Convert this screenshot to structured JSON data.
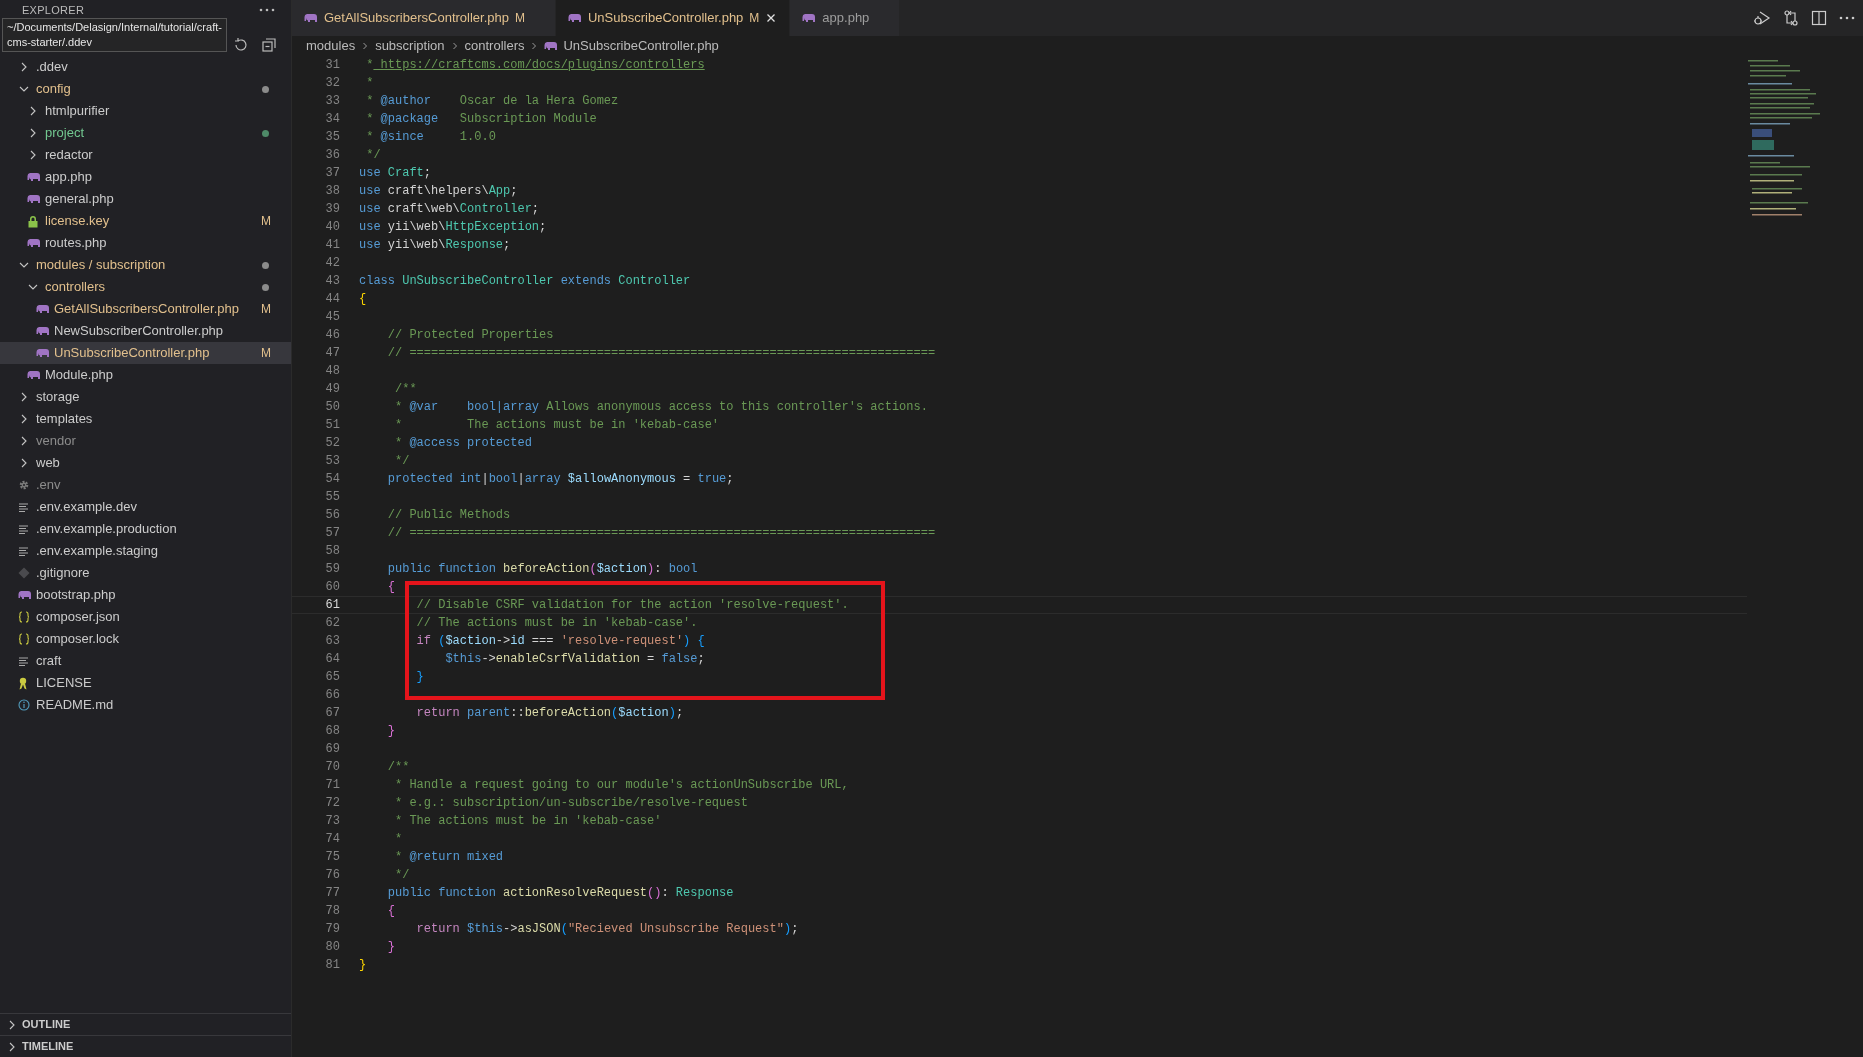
{
  "sidebar": {
    "title": "EXPLORER",
    "tooltip": "~/Documents/Delasign/Internal/tutorial/craft-\ncms-starter/.ddev",
    "tree": [
      {
        "name": ".ddev",
        "kind": "folder",
        "expanded": false,
        "selected": false
      },
      {
        "name": "config",
        "kind": "folder",
        "expanded": true,
        "color": "#e2c08d",
        "dot": {
          "color": "#8b8b8b"
        },
        "selected": false,
        "children": [
          {
            "name": "htmlpurifier",
            "kind": "folder",
            "expanded": false,
            "selected": false
          },
          {
            "name": "project",
            "kind": "folder",
            "expanded": false,
            "color": "#73c991",
            "dot": {
              "color": "#4e8a68"
            },
            "selected": false
          },
          {
            "name": "redactor",
            "kind": "folder",
            "expanded": false,
            "selected": false
          },
          {
            "name": "app.php",
            "kind": "php",
            "selected": false
          },
          {
            "name": "general.php",
            "kind": "php",
            "selected": false
          },
          {
            "name": "license.key",
            "kind": "key",
            "color": "#e2c08d",
            "badge": "M",
            "selected": false
          },
          {
            "name": "routes.php",
            "kind": "php",
            "selected": false
          }
        ]
      },
      {
        "name": "modules / subscription",
        "kind": "folder",
        "expanded": true,
        "color": "#e2c08d",
        "dot": {
          "color": "#8b8b8b"
        },
        "selected": false,
        "children": [
          {
            "name": "controllers",
            "kind": "folder",
            "expanded": true,
            "color": "#e2c08d",
            "dot": {
              "color": "#8b8b8b"
            },
            "selected": false,
            "children": [
              {
                "name": "GetAllSubscribersController.php",
                "kind": "php",
                "color": "#e2c08d",
                "badge": "M",
                "selected": false
              },
              {
                "name": "NewSubscriberController.php",
                "kind": "php",
                "selected": false
              },
              {
                "name": "UnSubscribeController.php",
                "kind": "php",
                "color": "#e2c08d",
                "badge": "M",
                "selected": true
              }
            ]
          },
          {
            "name": "Module.php",
            "kind": "php",
            "selected": false
          }
        ]
      },
      {
        "name": "storage",
        "kind": "folder",
        "expanded": false,
        "selected": false
      },
      {
        "name": "templates",
        "kind": "folder",
        "expanded": false,
        "selected": false
      },
      {
        "name": "vendor",
        "kind": "folder",
        "expanded": false,
        "color": "#8c8c8c",
        "selected": false
      },
      {
        "name": "web",
        "kind": "folder",
        "expanded": false,
        "selected": false
      },
      {
        "name": ".env",
        "kind": "settings",
        "color": "#8c8c8c",
        "selected": false
      },
      {
        "name": ".env.example.dev",
        "kind": "text",
        "selected": false
      },
      {
        "name": ".env.example.production",
        "kind": "text",
        "selected": false
      },
      {
        "name": ".env.example.staging",
        "kind": "text",
        "selected": false
      },
      {
        "name": ".gitignore",
        "kind": "git",
        "selected": false
      },
      {
        "name": "bootstrap.php",
        "kind": "php",
        "selected": false
      },
      {
        "name": "composer.json",
        "kind": "json",
        "selected": false
      },
      {
        "name": "composer.lock",
        "kind": "json",
        "selected": false
      },
      {
        "name": "craft",
        "kind": "text",
        "selected": false
      },
      {
        "name": "LICENSE",
        "kind": "license",
        "selected": false
      },
      {
        "name": "README.md",
        "kind": "info",
        "selected": false
      }
    ],
    "panels": [
      {
        "label": "OUTLINE",
        "expanded": false
      },
      {
        "label": "TIMELINE",
        "expanded": false
      }
    ]
  },
  "tabs": [
    {
      "label": "GetAllSubscribersController.php",
      "badge": "M",
      "color": "#e2c08d",
      "selected": false
    },
    {
      "label": "UnSubscribeController.php",
      "badge": "M",
      "color": "#e2c08d",
      "selected": true
    },
    {
      "label": "app.php",
      "selected": false
    }
  ],
  "breadcrumb": [
    {
      "label": "modules"
    },
    {
      "label": "subscription"
    },
    {
      "label": "controllers"
    },
    {
      "label": "UnSubscribeController.php",
      "kind": "php"
    }
  ],
  "editor": {
    "lines": [
      {
        "number": "31",
        "current": false,
        "tokens": [
          {
            "kind": "comment",
            "text": " *"
          },
          {
            "kind": "link",
            "text": " https://craftcms.com/docs/plugins/controllers"
          }
        ]
      },
      {
        "number": "32",
        "current": false,
        "tokens": [
          {
            "kind": "comment",
            "text": " *"
          }
        ]
      },
      {
        "number": "33",
        "current": false,
        "tokens": [
          {
            "kind": "comment",
            "text": " *"
          },
          {
            "kind": "doctag",
            "text": " @author"
          },
          {
            "kind": "comment",
            "text": "    Oscar de la Hera Gomez"
          }
        ]
      },
      {
        "number": "34",
        "current": false,
        "tokens": [
          {
            "kind": "comment",
            "text": " *"
          },
          {
            "kind": "doctag",
            "text": " @package"
          },
          {
            "kind": "comment",
            "text": "   Subscription Module"
          }
        ]
      },
      {
        "number": "35",
        "current": false,
        "tokens": [
          {
            "kind": "comment",
            "text": " *"
          },
          {
            "kind": "doctag",
            "text": " @since"
          },
          {
            "kind": "comment",
            "text": "     1.0.0"
          }
        ]
      },
      {
        "number": "36",
        "current": false,
        "tokens": [
          {
            "kind": "comment",
            "text": " */"
          }
        ]
      },
      {
        "number": "37",
        "current": false,
        "tokens": [
          {
            "kind": "keyword",
            "text": "use"
          },
          {
            "kind": "type",
            "text": " Craft"
          },
          {
            "kind": "plain",
            "text": ";"
          }
        ]
      },
      {
        "number": "38",
        "current": false,
        "tokens": [
          {
            "kind": "keyword",
            "text": "use"
          },
          {
            "kind": "plain",
            "text": " craft\\helpers\\"
          },
          {
            "kind": "type",
            "text": "App"
          },
          {
            "kind": "plain",
            "text": ";"
          }
        ]
      },
      {
        "number": "39",
        "current": false,
        "tokens": [
          {
            "kind": "keyword",
            "text": "use"
          },
          {
            "kind": "plain",
            "text": " craft\\web\\"
          },
          {
            "kind": "type",
            "text": "Controller"
          },
          {
            "kind": "plain",
            "text": ";"
          }
        ]
      },
      {
        "number": "40",
        "current": false,
        "tokens": [
          {
            "kind": "keyword",
            "text": "use"
          },
          {
            "kind": "plain",
            "text": " yii\\web\\"
          },
          {
            "kind": "type",
            "text": "HttpException"
          },
          {
            "kind": "plain",
            "text": ";"
          }
        ]
      },
      {
        "number": "41",
        "current": false,
        "tokens": [
          {
            "kind": "keyword",
            "text": "use"
          },
          {
            "kind": "plain",
            "text": " yii\\web\\"
          },
          {
            "kind": "type",
            "text": "Response"
          },
          {
            "kind": "plain",
            "text": ";"
          }
        ]
      },
      {
        "number": "42",
        "current": false
      },
      {
        "number": "43",
        "current": false,
        "tokens": [
          {
            "kind": "keyword",
            "text": "class"
          },
          {
            "kind": "type",
            "text": " UnSubscribeController"
          },
          {
            "kind": "keyword",
            "text": " extends"
          },
          {
            "kind": "type",
            "text": " Controller"
          }
        ]
      },
      {
        "number": "44",
        "current": false,
        "tokens": [
          {
            "kind": "bracket1",
            "text": "{"
          }
        ]
      },
      {
        "number": "45",
        "current": false
      },
      {
        "number": "46",
        "current": false,
        "tokens": [
          {
            "kind": "comment",
            "text": "    // Protected Properties"
          }
        ]
      },
      {
        "number": "47",
        "current": false,
        "tokens": [
          {
            "kind": "comment",
            "text": "    // ========================================================================="
          }
        ]
      },
      {
        "number": "48",
        "current": false
      },
      {
        "number": "49",
        "current": false,
        "tokens": [
          {
            "kind": "comment",
            "text": "     /**"
          }
        ]
      },
      {
        "number": "50",
        "current": false,
        "tokens": [
          {
            "kind": "comment",
            "text": "     *"
          },
          {
            "kind": "doctag",
            "text": " @var"
          },
          {
            "kind": "doctag",
            "text": "    bool|array"
          },
          {
            "kind": "comment",
            "text": " Allows anonymous access to this controller's actions."
          }
        ]
      },
      {
        "number": "51",
        "current": false,
        "tokens": [
          {
            "kind": "comment",
            "text": "     *         The actions must be in 'kebab-case'"
          }
        ]
      },
      {
        "number": "52",
        "current": false,
        "tokens": [
          {
            "kind": "comment",
            "text": "     *"
          },
          {
            "kind": "doctag",
            "text": " @access"
          },
          {
            "kind": "doctag",
            "text": " protected"
          }
        ]
      },
      {
        "number": "53",
        "current": false,
        "tokens": [
          {
            "kind": "comment",
            "text": "     */"
          }
        ]
      },
      {
        "number": "54",
        "current": false,
        "tokens": [
          {
            "kind": "keyword",
            "text": "    protected"
          },
          {
            "kind": "keyword",
            "text": " int"
          },
          {
            "kind": "plain",
            "text": "|"
          },
          {
            "kind": "keyword",
            "text": "bool"
          },
          {
            "kind": "plain",
            "text": "|"
          },
          {
            "kind": "keyword",
            "text": "array"
          },
          {
            "kind": "var",
            "text": " $allowAnonymous"
          },
          {
            "kind": "plain",
            "text": " = "
          },
          {
            "kind": "keyword",
            "text": "true"
          },
          {
            "kind": "plain",
            "text": ";"
          }
        ]
      },
      {
        "number": "55",
        "current": false
      },
      {
        "number": "56",
        "current": false,
        "tokens": [
          {
            "kind": "comment",
            "text": "    // Public Methods"
          }
        ]
      },
      {
        "number": "57",
        "current": false,
        "tokens": [
          {
            "kind": "comment",
            "text": "    // ========================================================================="
          }
        ]
      },
      {
        "number": "58",
        "current": false
      },
      {
        "number": "59",
        "current": false,
        "tokens": [
          {
            "kind": "keyword",
            "text": "    public"
          },
          {
            "kind": "keyword",
            "text": " function"
          },
          {
            "kind": "func",
            "text": " beforeAction"
          },
          {
            "kind": "bracket2",
            "text": "("
          },
          {
            "kind": "var",
            "text": "$action"
          },
          {
            "kind": "bracket2",
            "text": ")"
          },
          {
            "kind": "plain",
            "text": ":"
          },
          {
            "kind": "keyword",
            "text": " bool"
          }
        ]
      },
      {
        "number": "60",
        "current": false,
        "tokens": [
          {
            "kind": "bracket2",
            "text": "    {"
          }
        ]
      },
      {
        "number": "61",
        "current": true,
        "tokens": [
          {
            "kind": "comment",
            "text": "        // Disable CSRF validation for the action 'resolve-request'."
          }
        ]
      },
      {
        "number": "62",
        "current": false,
        "tokens": [
          {
            "kind": "comment",
            "text": "        // The actions must be in 'kebab-case'."
          }
        ]
      },
      {
        "number": "63",
        "current": false,
        "tokens": [
          {
            "kind": "control",
            "text": "        if"
          },
          {
            "kind": "bracket3",
            "text": " ("
          },
          {
            "kind": "var",
            "text": "$action"
          },
          {
            "kind": "plain",
            "text": "->"
          },
          {
            "kind": "var",
            "text": "id"
          },
          {
            "kind": "plain",
            "text": " === "
          },
          {
            "kind": "string",
            "text": "'resolve-request'"
          },
          {
            "kind": "bracket3",
            "text": ")"
          },
          {
            "kind": "bracket3",
            "text": " {"
          }
        ]
      },
      {
        "number": "64",
        "current": false,
        "tokens": [
          {
            "kind": "keyword",
            "text": "            $this"
          },
          {
            "kind": "plain",
            "text": "->"
          },
          {
            "kind": "func",
            "text": "enableCsrfValidation"
          },
          {
            "kind": "plain",
            "text": " = "
          },
          {
            "kind": "keyword",
            "text": "false"
          },
          {
            "kind": "plain",
            "text": ";"
          }
        ]
      },
      {
        "number": "65",
        "current": false,
        "tokens": [
          {
            "kind": "bracket3",
            "text": "        }"
          }
        ]
      },
      {
        "number": "66",
        "current": false
      },
      {
        "number": "67",
        "current": false,
        "tokens": [
          {
            "kind": "control",
            "text": "        return"
          },
          {
            "kind": "keyword",
            "text": " parent"
          },
          {
            "kind": "plain",
            "text": "::"
          },
          {
            "kind": "func",
            "text": "beforeAction"
          },
          {
            "kind": "bracket3",
            "text": "("
          },
          {
            "kind": "var",
            "text": "$action"
          },
          {
            "kind": "bracket3",
            "text": ")"
          },
          {
            "kind": "plain",
            "text": ";"
          }
        ]
      },
      {
        "number": "68",
        "current": false,
        "tokens": [
          {
            "kind": "bracket2",
            "text": "    }"
          }
        ]
      },
      {
        "number": "69",
        "current": false
      },
      {
        "number": "70",
        "current": false,
        "tokens": [
          {
            "kind": "comment",
            "text": "    /**"
          }
        ]
      },
      {
        "number": "71",
        "current": false,
        "tokens": [
          {
            "kind": "comment",
            "text": "     * Handle a request going to our module's actionUnSubscribe URL,"
          }
        ]
      },
      {
        "number": "72",
        "current": false,
        "tokens": [
          {
            "kind": "comment",
            "text": "     * e.g.: subscription/un-subscribe/resolve-request"
          }
        ]
      },
      {
        "number": "73",
        "current": false,
        "tokens": [
          {
            "kind": "comment",
            "text": "     * The actions must be in 'kebab-case'"
          }
        ]
      },
      {
        "number": "74",
        "current": false,
        "tokens": [
          {
            "kind": "comment",
            "text": "     *"
          }
        ]
      },
      {
        "number": "75",
        "current": false,
        "tokens": [
          {
            "kind": "comment",
            "text": "     *"
          },
          {
            "kind": "doctag",
            "text": " @return"
          },
          {
            "kind": "doctag",
            "text": " mixed"
          }
        ]
      },
      {
        "number": "76",
        "current": false,
        "tokens": [
          {
            "kind": "comment",
            "text": "     */"
          }
        ]
      },
      {
        "number": "77",
        "current": false,
        "tokens": [
          {
            "kind": "keyword",
            "text": "    public"
          },
          {
            "kind": "keyword",
            "text": " function"
          },
          {
            "kind": "func",
            "text": " actionResolveRequest"
          },
          {
            "kind": "bracket2",
            "text": "()"
          },
          {
            "kind": "plain",
            "text": ":"
          },
          {
            "kind": "type",
            "text": " Response"
          }
        ]
      },
      {
        "number": "78",
        "current": false,
        "tokens": [
          {
            "kind": "bracket2",
            "text": "    {"
          }
        ]
      },
      {
        "number": "79",
        "current": false,
        "tokens": [
          {
            "kind": "control",
            "text": "        return"
          },
          {
            "kind": "keyword",
            "text": " $this"
          },
          {
            "kind": "plain",
            "text": "->"
          },
          {
            "kind": "func",
            "text": "asJSON"
          },
          {
            "kind": "bracket3",
            "text": "("
          },
          {
            "kind": "string",
            "text": "\"Recieved Unsubscribe Request\""
          },
          {
            "kind": "bracket3",
            "text": ")"
          },
          {
            "kind": "plain",
            "text": ";"
          }
        ]
      },
      {
        "number": "80",
        "current": false,
        "tokens": [
          {
            "kind": "bracket2",
            "text": "    }"
          }
        ]
      },
      {
        "number": "81",
        "current": false,
        "tokens": [
          {
            "kind": "bracket1",
            "text": "}"
          }
        ]
      }
    ]
  }
}
